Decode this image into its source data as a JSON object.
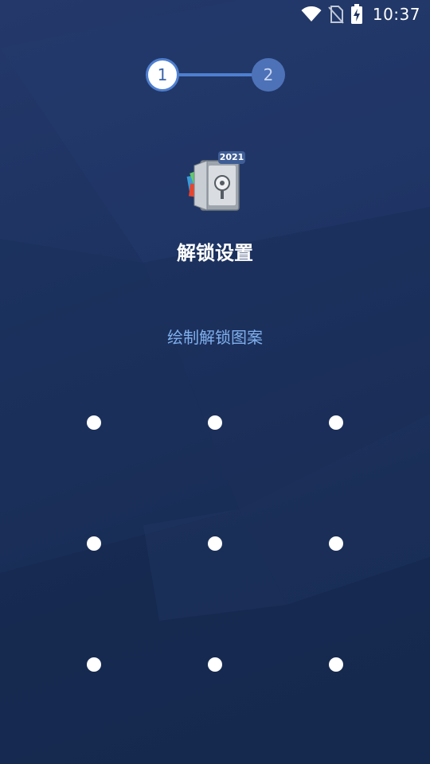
{
  "status_bar": {
    "time": "10:37",
    "icons": [
      "wifi-icon",
      "no-sim-icon",
      "battery-charging-icon"
    ]
  },
  "stepper": {
    "steps": [
      {
        "label": "1",
        "state": "active"
      },
      {
        "label": "2",
        "state": "upcoming"
      }
    ],
    "accent_color": "#4e7fd0"
  },
  "app_icon": {
    "name": "vault-app-icon",
    "badge": "2021"
  },
  "title": "解锁设置",
  "hint": "绘制解锁图案",
  "pattern": {
    "rows": 3,
    "cols": 3,
    "nodes": [
      "1",
      "2",
      "3",
      "4",
      "5",
      "6",
      "7",
      "8",
      "9"
    ]
  },
  "colors": {
    "background": "#1b2e52",
    "hint_text": "#7fb0ee",
    "dot": "#ffffff"
  }
}
